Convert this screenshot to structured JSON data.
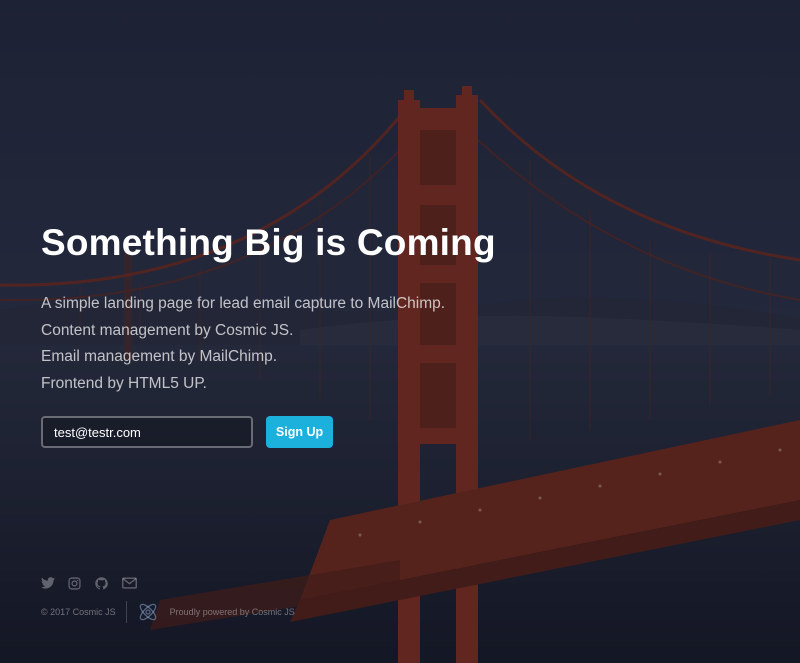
{
  "hero": {
    "headline": "Something Big is Coming",
    "description_lines": [
      "A simple landing page for lead email capture to MailChimp.",
      "Content management by Cosmic JS.",
      "Email management by MailChimp.",
      "Frontend by HTML5 UP."
    ]
  },
  "signup": {
    "email_value": "test@testr.com",
    "button_label": "Sign Up"
  },
  "social": {
    "icons": [
      "twitter-icon",
      "instagram-icon",
      "github-icon",
      "email-icon"
    ]
  },
  "footer": {
    "copyright": "© 2017 Cosmic JS",
    "powered": "Proudly powered by Cosmic JS"
  },
  "colors": {
    "accent": "#1cb0dd",
    "bridge": "#8a2f1c",
    "overlay": "#1a1d2b"
  }
}
